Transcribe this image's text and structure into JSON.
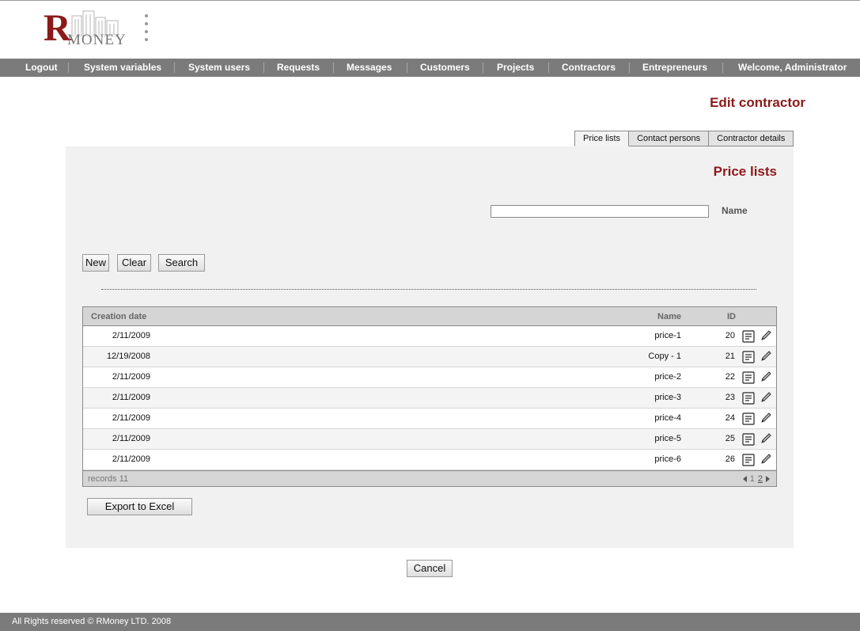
{
  "logo": {
    "letter": "R",
    "word": "MONEY"
  },
  "nav": {
    "items": [
      "Logout",
      "System variables",
      "System users",
      "Requests",
      "Messages",
      "Customers",
      "Projects",
      "Contractors",
      "Entrepreneurs"
    ],
    "welcome": "Welcome, Administrator"
  },
  "page": {
    "title": "Edit contractor"
  },
  "tabs": [
    {
      "label": "Price lists",
      "active": true
    },
    {
      "label": "Contact persons",
      "active": false
    },
    {
      "label": "Contractor details",
      "active": false
    }
  ],
  "panel": {
    "title": "Price lists",
    "search": {
      "name_label": "Name",
      "name_value": ""
    },
    "buttons": {
      "new": "New",
      "clear": "Clear",
      "search": "Search"
    }
  },
  "grid": {
    "headers": {
      "date": "Creation date",
      "name": "Name",
      "id": "ID"
    },
    "rows": [
      {
        "date": "2/11/2009",
        "name": "price-1",
        "id": "20"
      },
      {
        "date": "12/19/2008",
        "name": "Copy - 1",
        "id": "21"
      },
      {
        "date": "2/11/2009",
        "name": "price-2",
        "id": "22"
      },
      {
        "date": "2/11/2009",
        "name": "price-3",
        "id": "23"
      },
      {
        "date": "2/11/2009",
        "name": "price-4",
        "id": "24"
      },
      {
        "date": "2/11/2009",
        "name": "price-5",
        "id": "25"
      },
      {
        "date": "2/11/2009",
        "name": "price-6",
        "id": "26"
      }
    ],
    "footer": {
      "records": "records 11",
      "page_current": "1",
      "page_next": "2"
    }
  },
  "export_label": "Export to Excel",
  "cancel_label": "Cancel",
  "footer": {
    "copyright": "All Rights reserved © RMoney LTD. 2008"
  },
  "colors": {
    "brand": "#8b1a1a",
    "navbar": "#7b7b7b",
    "panel": "#f2f1f1"
  }
}
